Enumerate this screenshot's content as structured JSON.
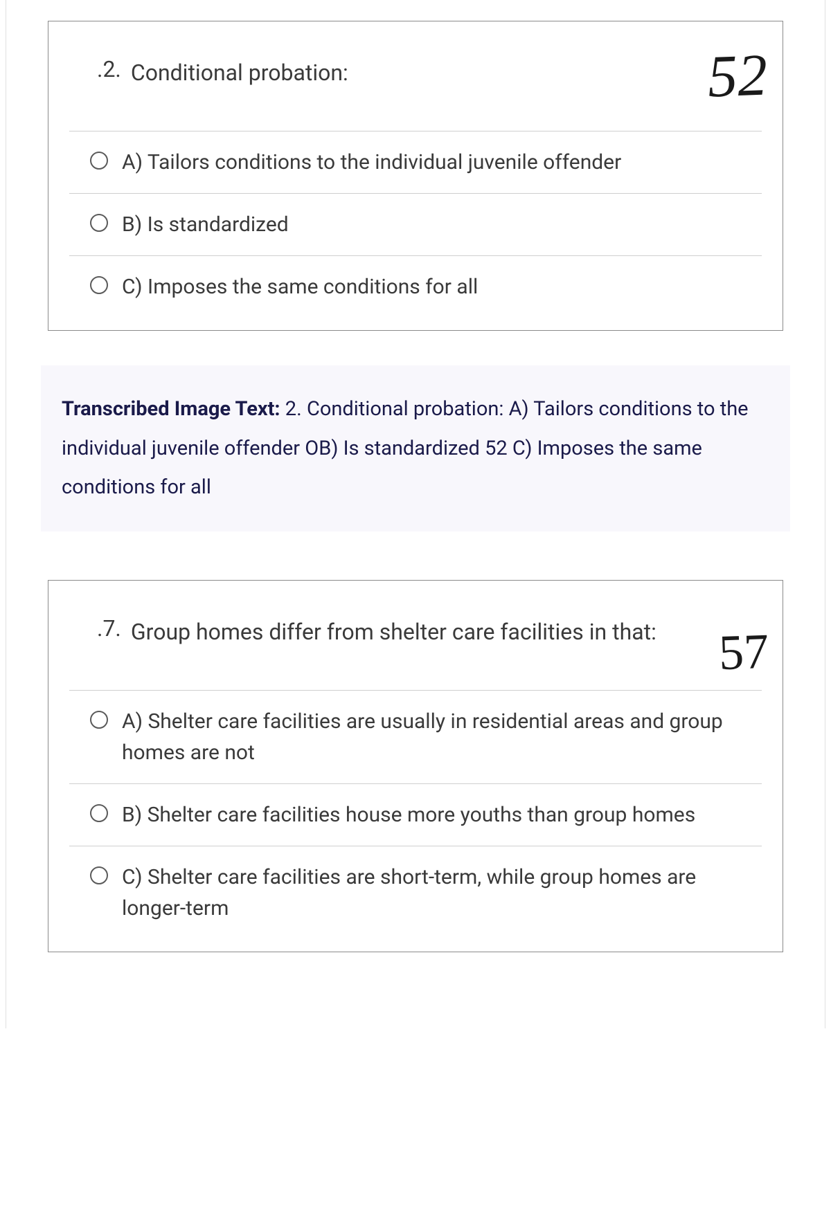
{
  "question1": {
    "number": ".2.",
    "text": "Conditional probation:",
    "handwritten": "52",
    "options": [
      "A) Tailors conditions to the individual juvenile offender",
      "B) Is standardized",
      "C) Imposes the same conditions for all"
    ]
  },
  "transcribed": {
    "label": "Transcribed Image Text:",
    "body": " 2. Conditional probation: A) Tailors conditions to the individual juvenile offender OB) Is standardized 52 C) Imposes the same conditions for all"
  },
  "question2": {
    "number": ".7.",
    "text": "Group homes differ from shelter care facilities in that:",
    "handwritten": "57",
    "options": [
      "A) Shelter care facilities are usually in residential areas and group homes are not",
      "B) Shelter care facilities house more youths than group homes",
      "C) Shelter care facilities are short-term, while group homes are longer-term"
    ]
  }
}
